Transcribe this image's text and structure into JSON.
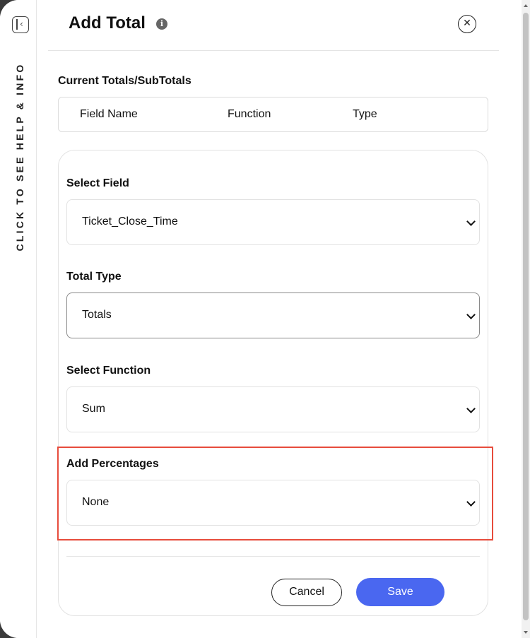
{
  "dialog": {
    "title": "Add Total",
    "info_icon": "i",
    "close_icon": "✕"
  },
  "help_rail": {
    "label": "CLICK TO SEE HELP & INFO"
  },
  "current_totals": {
    "heading": "Current Totals/SubTotals",
    "columns": [
      "Field Name",
      "Function",
      "Type"
    ]
  },
  "form": {
    "select_field": {
      "label": "Select Field",
      "value": "Ticket_Close_Time"
    },
    "total_type": {
      "label": "Total Type",
      "value": "Totals"
    },
    "select_function": {
      "label": "Select Function",
      "value": "Sum"
    },
    "add_percentages": {
      "label": "Add Percentages",
      "value": "None"
    }
  },
  "actions": {
    "cancel_label": "Cancel",
    "save_label": "Save"
  },
  "colors": {
    "primary": "#4a67f0",
    "highlight": "#e74c3c"
  },
  "icons": {
    "collapse": "collapse-panel-icon",
    "info": "info-icon",
    "close": "close-icon",
    "dropdown": "chevron-down-icon"
  }
}
